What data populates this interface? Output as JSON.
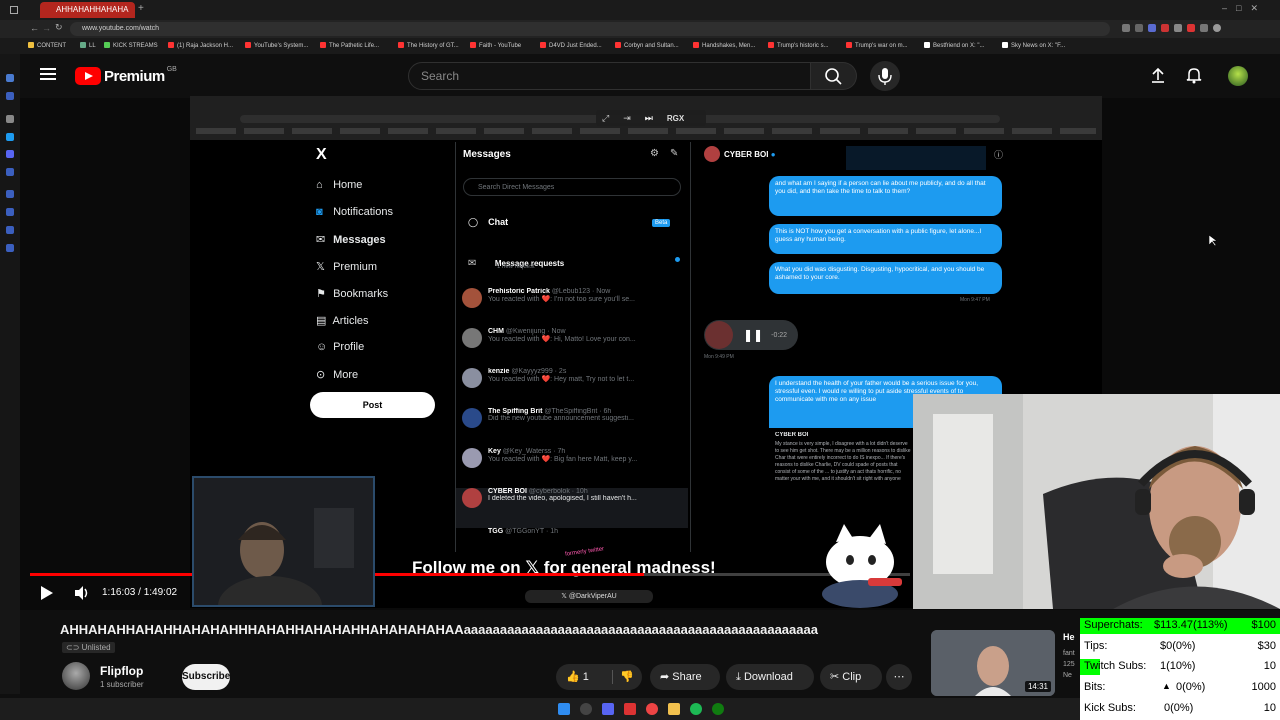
{
  "browser": {
    "active_tab": "AHHAHAHHAHAHA",
    "url": "www.youtube.com/watch",
    "bookmarks": [
      "CONTENT",
      "LL",
      "KICK STREAMS",
      "(1) Raja Jackson H...",
      "YouTube's System...",
      "The Pathetic Life...",
      "The History of GT...",
      "Faith - YouTube",
      "D4VD Just Ended...",
      "Corbyn and Sultan...",
      "Handshakes, Men...",
      "Trump's historic s...",
      "Trump's war on m...",
      "Bestfriend on X: \"...",
      "Sky News on X: \"F..."
    ]
  },
  "youtube": {
    "logo_text": "Premium",
    "region": "GB",
    "search_placeholder": "Search"
  },
  "screen_in_video": {
    "toolbar_label": "RGX",
    "x_logo": "X",
    "nav": [
      "Home",
      "Notifications",
      "Messages",
      "Premium",
      "Bookmarks",
      "Articles",
      "Profile",
      "More"
    ],
    "post_label": "Post",
    "messages_title": "Messages",
    "search_dm": "Search Direct Messages",
    "chat_label": "Chat",
    "beta": "Beta",
    "requests_title": "Message requests",
    "requests_sub": "1 new request",
    "conversations": [
      {
        "name": "Prehistoric Patrick",
        "handle": "@Lebub123 · Now",
        "preview": "You reacted with ❤️: I'm not too sure you'll se..."
      },
      {
        "name": "CHM",
        "handle": "@Kwenijung · Now",
        "preview": "You reacted with ❤️: Hi, Matto! Love your con..."
      },
      {
        "name": "kenzie",
        "handle": "@Kayyyz999 · 2s",
        "preview": "You reacted with ❤️: Hey matt, Try not to let t..."
      },
      {
        "name": "The Spiffing Brit",
        "handle": "@TheSpiffingBrit · 6h",
        "preview": "Did the new youtube announcement suggesti..."
      },
      {
        "name": "Key",
        "handle": "@Key_Waterss · 7h",
        "preview": "You reacted with ❤️: Big fan here Matt, keep y..."
      },
      {
        "name": "CYBER BOI",
        "handle": "@cyberbolok · 10h",
        "preview": "I deleted the video, apologised, I still haven't h..."
      },
      {
        "name": "TGG",
        "handle": "@TGGonYT · 1h",
        "preview": ""
      }
    ],
    "chat_header": "CYBER BOI",
    "bubbles": [
      "and what am I saying if a person can lie about me publicly, and do all that you did, and then take the time to talk to them?",
      "This is NOT how you get a conversation with a public figure, let alone...I guess any human being.",
      "What you did was disgusting. Disgusting, hypocritical, and you should be ashamed to your core."
    ],
    "bubble_time": "Mon 9:47 PM",
    "voice_time": "-0:22",
    "voice_stamp": "Mon 9:49 PM",
    "bubble4": "I understand the health of your father would be a serious issue for you, stressful even. I would re willing to put aside stressful events of to communicate with me on any issue",
    "quote_name": "CYBER BOI",
    "quote_text": "My stance is very simple, I disagree with a lot didn't deserve to see him get shot. There may be a million reasons to dislike Char that were entirely incorrect to do IS inexpo... If there's reasons to dislike Charlie, DV could spade of posts that consist of some of the ... to justify an act thats horrific, no matter your with me, and it shouldn't sit right with anyone"
  },
  "banner": {
    "text": "Follow me on 𝕏 for general madness!",
    "sticker": "formerly twitter",
    "handle": "𝕏 @DarkViperAU"
  },
  "player": {
    "time": "1:16:03 / 1:49:02",
    "progress": 0.698
  },
  "video": {
    "title": "AHHAHAHHAHAHHAHAHAHHHAHAHHAHAHAHHAHAHAHAHAAaaaaaaaaaaaaaaaaaaaaaaaaaaaaaaaaaaaaaaaaaaaaaaaaa",
    "visibility": "Unlisted",
    "channel": "Flipflop",
    "subscribers": "1 subscriber",
    "subscribe": "Subscribe",
    "likes": "1",
    "share": "Share",
    "download": "Download",
    "clip": "Clip",
    "thumb_duration": "14:31",
    "thumb_partial": "He",
    "thumb_sub1": "fant",
    "thumb_sub2": "125",
    "thumb_sub3": "Ne"
  },
  "overlay": {
    "rows": [
      {
        "label": "Superchats:",
        "value": "$113.47(113%)",
        "goal": "$100"
      },
      {
        "label": "Tips:",
        "value": "$0(0%)",
        "goal": "$30"
      },
      {
        "label": "Twitch Subs:",
        "value": "1(10%)",
        "goal": "10"
      },
      {
        "label": "Bits:",
        "value": "0(0%)",
        "goal": "1000"
      },
      {
        "label": "Kick Subs:",
        "value": "0(0%)",
        "goal": "10"
      }
    ]
  },
  "colors": {
    "yt_red": "#ff0000",
    "x_blue": "#1d9bf0",
    "overlay_green": "#00ff00"
  }
}
